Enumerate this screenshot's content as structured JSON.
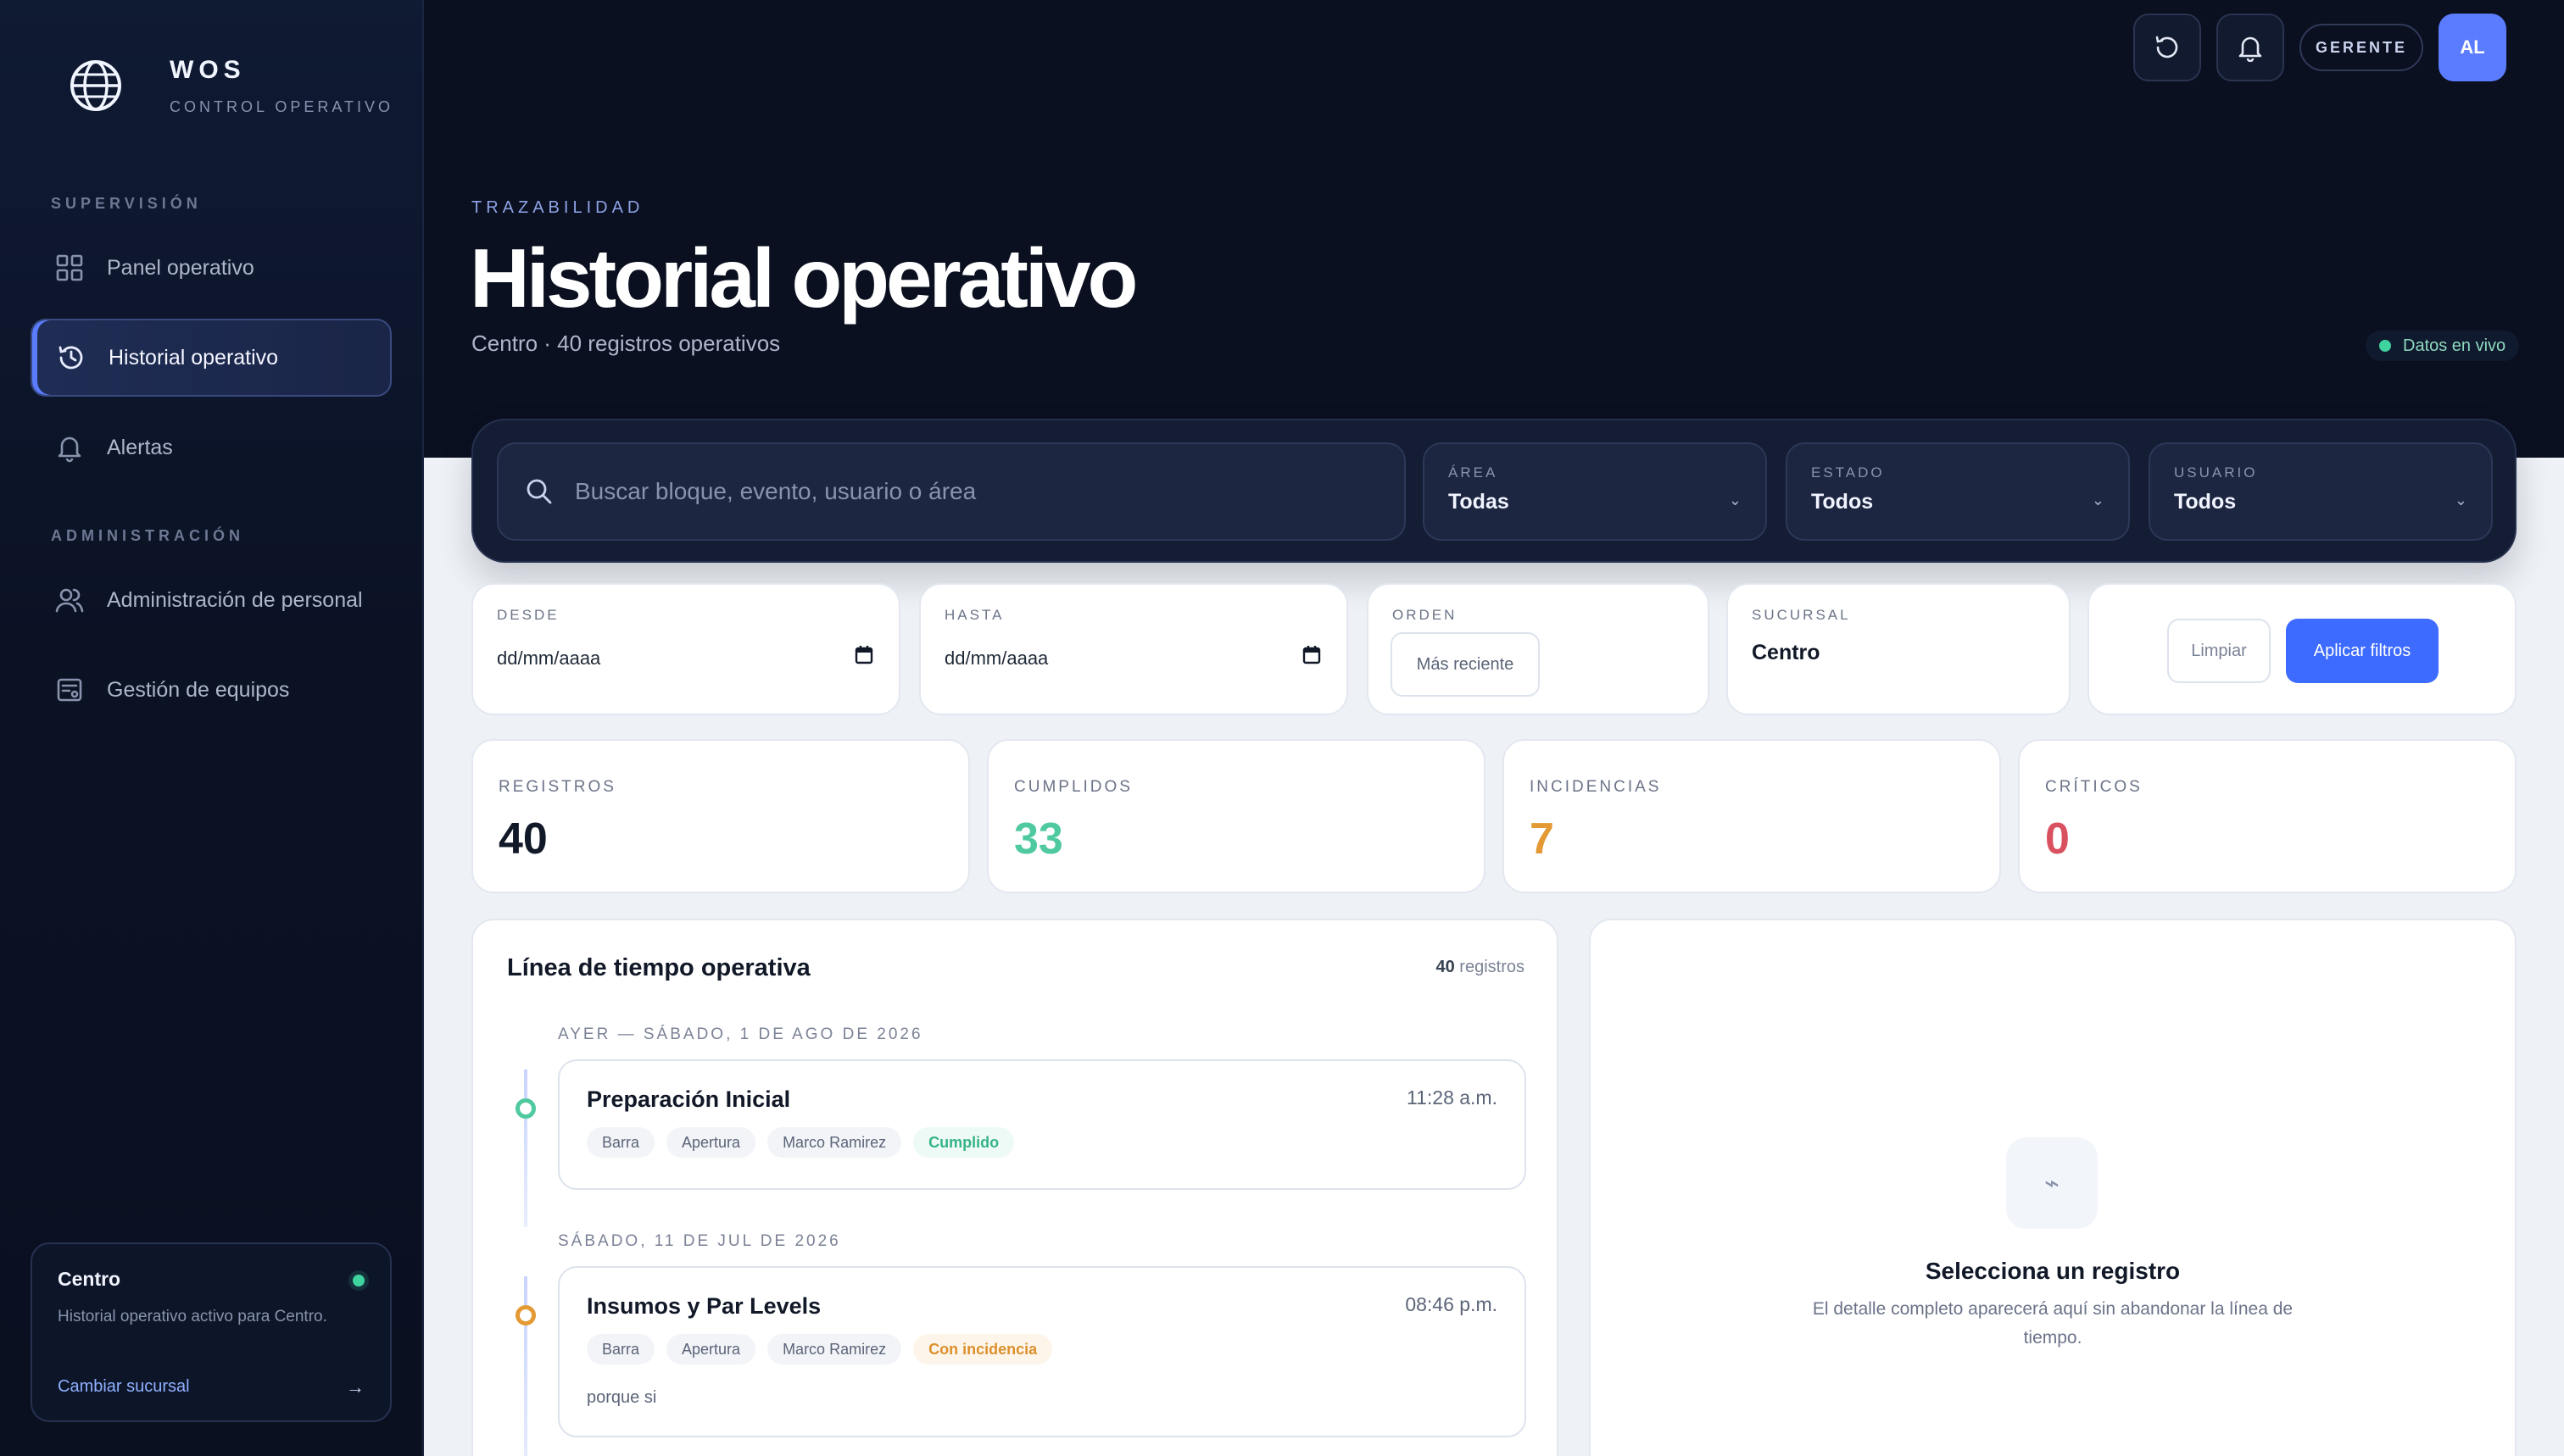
{
  "brand": {
    "name": "WOS",
    "subtitle": "CONTROL OPERATIVO"
  },
  "sidebar": {
    "sections": [
      {
        "title": "SUPERVISIÓN",
        "items": [
          {
            "label": "Panel operativo"
          },
          {
            "label": "Historial operativo",
            "active": true
          },
          {
            "label": "Alertas"
          }
        ]
      },
      {
        "title": "ADMINISTRACIÓN",
        "items": [
          {
            "label": "Administración de personal"
          },
          {
            "label": "Gestión de equipos"
          }
        ]
      }
    ],
    "branch_card": {
      "title": "Centro",
      "description": "Historial operativo activo para Centro.",
      "link": "Cambiar sucursal",
      "arrow": "→"
    }
  },
  "topbar": {
    "role": "GERENTE",
    "avatar": "AL"
  },
  "header": {
    "eyebrow": "TRAZABILIDAD",
    "title": "Historial operativo",
    "subtitle": "Centro · 40 registros operativos",
    "live_label": "Datos en vivo"
  },
  "filters": {
    "search_placeholder": "Buscar bloque, evento, usuario o área",
    "dropdowns": [
      {
        "label": "ÁREA",
        "value": "Todas"
      },
      {
        "label": "ESTADO",
        "value": "Todos"
      },
      {
        "label": "USUARIO",
        "value": "Todos"
      }
    ],
    "chevron": "⌄",
    "from": {
      "label": "DESDE",
      "value": "dd/mm/aaaa"
    },
    "to": {
      "label": "HASTA",
      "value": "dd/mm/aaaa"
    },
    "order": {
      "label": "ORDEN",
      "value": "Más reciente"
    },
    "branch": {
      "label": "SUCURSAL",
      "value": "Centro"
    },
    "clear_label": "Limpiar",
    "apply_label": "Aplicar filtros"
  },
  "stats": [
    {
      "label": "REGISTROS",
      "value": "40",
      "color": "#111827"
    },
    {
      "label": "CUMPLIDOS",
      "value": "33",
      "color": "#4fc9a0"
    },
    {
      "label": "INCIDENCIAS",
      "value": "7",
      "color": "#e39a35"
    },
    {
      "label": "CRÍTICOS",
      "value": "0",
      "color": "#d9515f"
    }
  ],
  "timeline": {
    "title": "Línea de tiempo operativa",
    "count_number": "40",
    "count_suffix": "registros",
    "groups": [
      {
        "day": "AYER — SÁBADO, 1 DE AGO DE 2026",
        "entries": [
          {
            "title": "Preparación Inicial",
            "time": "11:28 a.m.",
            "tags": [
              "Barra",
              "Apertura",
              "Marco Ramirez"
            ],
            "status": "Cumplido",
            "status_color": "#4fc9a0"
          }
        ]
      },
      {
        "day": "SÁBADO, 11 DE JUL DE 2026",
        "entries": [
          {
            "title": "Insumos y Par Levels",
            "time": "08:46 p.m.",
            "tags": [
              "Barra",
              "Apertura",
              "Marco Ramirez"
            ],
            "status": "Con incidencia",
            "status_color": "#e39a35",
            "note": "porque si"
          }
        ]
      }
    ]
  },
  "detail": {
    "icon": "⌁",
    "title": "Selecciona un registro",
    "description": "El detalle completo aparecerá aquí sin abandonar la línea de tiempo."
  }
}
